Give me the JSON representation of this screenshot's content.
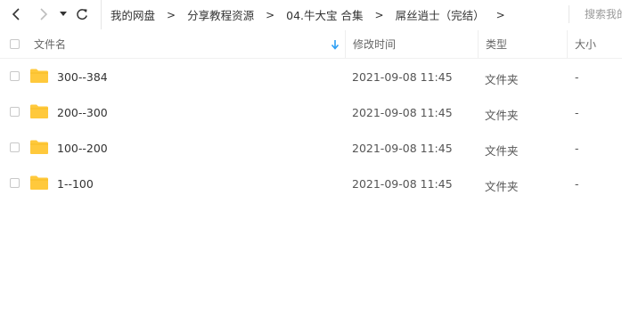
{
  "nav": {
    "back_icon": "chevron-left-icon",
    "forward_icon": "chevron-right-icon",
    "dropdown_icon": "caret-down-icon",
    "refresh_icon": "refresh-icon"
  },
  "breadcrumb": {
    "items": [
      "我的网盘",
      "分享教程资源",
      "04.牛大宝 合集",
      "屌丝逍士（完结）"
    ],
    "separator": ">"
  },
  "search": {
    "placeholder": "搜索我的网盘"
  },
  "columns": {
    "name": "文件名",
    "modified": "修改时间",
    "type": "类型",
    "size": "大小"
  },
  "files": [
    {
      "name": "300--384",
      "modified": "2021-09-08 11:45",
      "type": "文件夹",
      "size": "-"
    },
    {
      "name": "200--300",
      "modified": "2021-09-08 11:45",
      "type": "文件夹",
      "size": "-"
    },
    {
      "name": "100--200",
      "modified": "2021-09-08 11:45",
      "type": "文件夹",
      "size": "-"
    },
    {
      "name": "1--100",
      "modified": "2021-09-08 11:45",
      "type": "文件夹",
      "size": "-"
    }
  ],
  "colors": {
    "folder": "#FFC93C",
    "sort_arrow": "#2c9ef4",
    "text": "#333333",
    "muted": "#666666"
  }
}
